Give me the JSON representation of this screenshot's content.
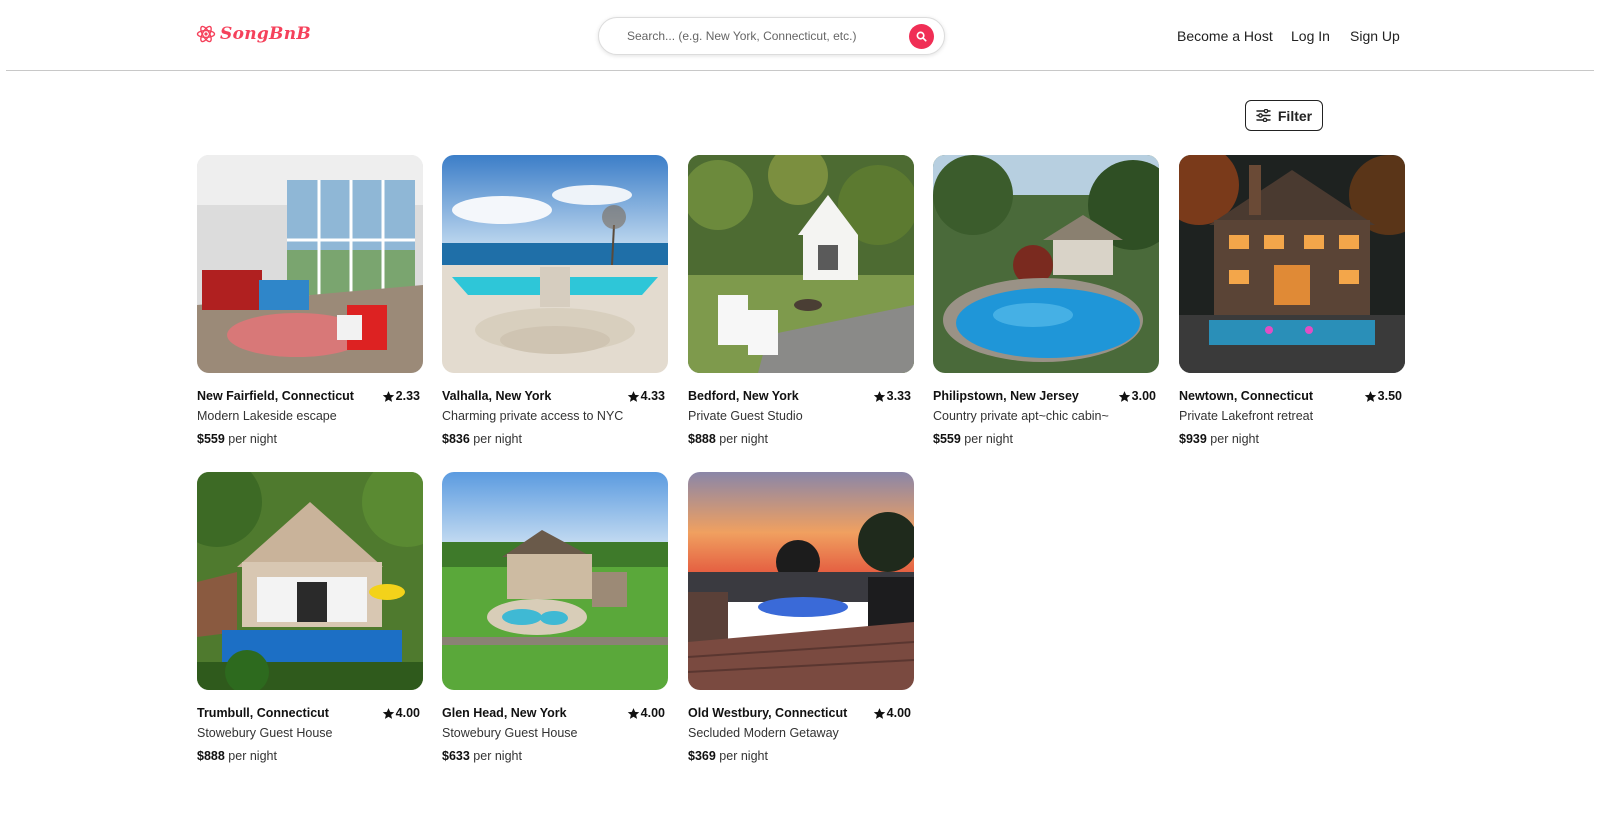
{
  "header": {
    "logo_text": "SongBnB",
    "search_placeholder": "Search... (e.g. New York, Connecticut, etc.)",
    "nav": {
      "host": "Become a Host",
      "login": "Log In",
      "signup": "Sign Up"
    }
  },
  "filter_label": "Filter",
  "price_suffix": "per night",
  "colors": {
    "brand": "#f5415b",
    "search_button": "#f02e55"
  },
  "listings": [
    {
      "location": "New Fairfield, Connecticut",
      "rating": "2.33",
      "title": "Modern Lakeside escape",
      "price": "$559"
    },
    {
      "location": "Valhalla, New York",
      "rating": "4.33",
      "title": "Charming private access to NYC",
      "price": "$836"
    },
    {
      "location": "Bedford, New York",
      "rating": "3.33",
      "title": "Private Guest Studio",
      "price": "$888"
    },
    {
      "location": "Philipstown, New Jersey",
      "rating": "3.00",
      "title": "Country private apt~chic cabin~",
      "price": "$559"
    },
    {
      "location": "Newtown, Connecticut",
      "rating": "3.50",
      "title": "Private Lakefront retreat",
      "price": "$939"
    },
    {
      "location": "Trumbull, Connecticut",
      "rating": "4.00",
      "title": "Stowebury Guest House",
      "price": "$888"
    },
    {
      "location": "Glen Head, New York",
      "rating": "4.00",
      "title": "Stowebury Guest House",
      "price": "$633"
    },
    {
      "location": "Old Westbury, Connecticut",
      "rating": "4.00",
      "title": "Secluded Modern Getaway",
      "price": "$369"
    }
  ]
}
